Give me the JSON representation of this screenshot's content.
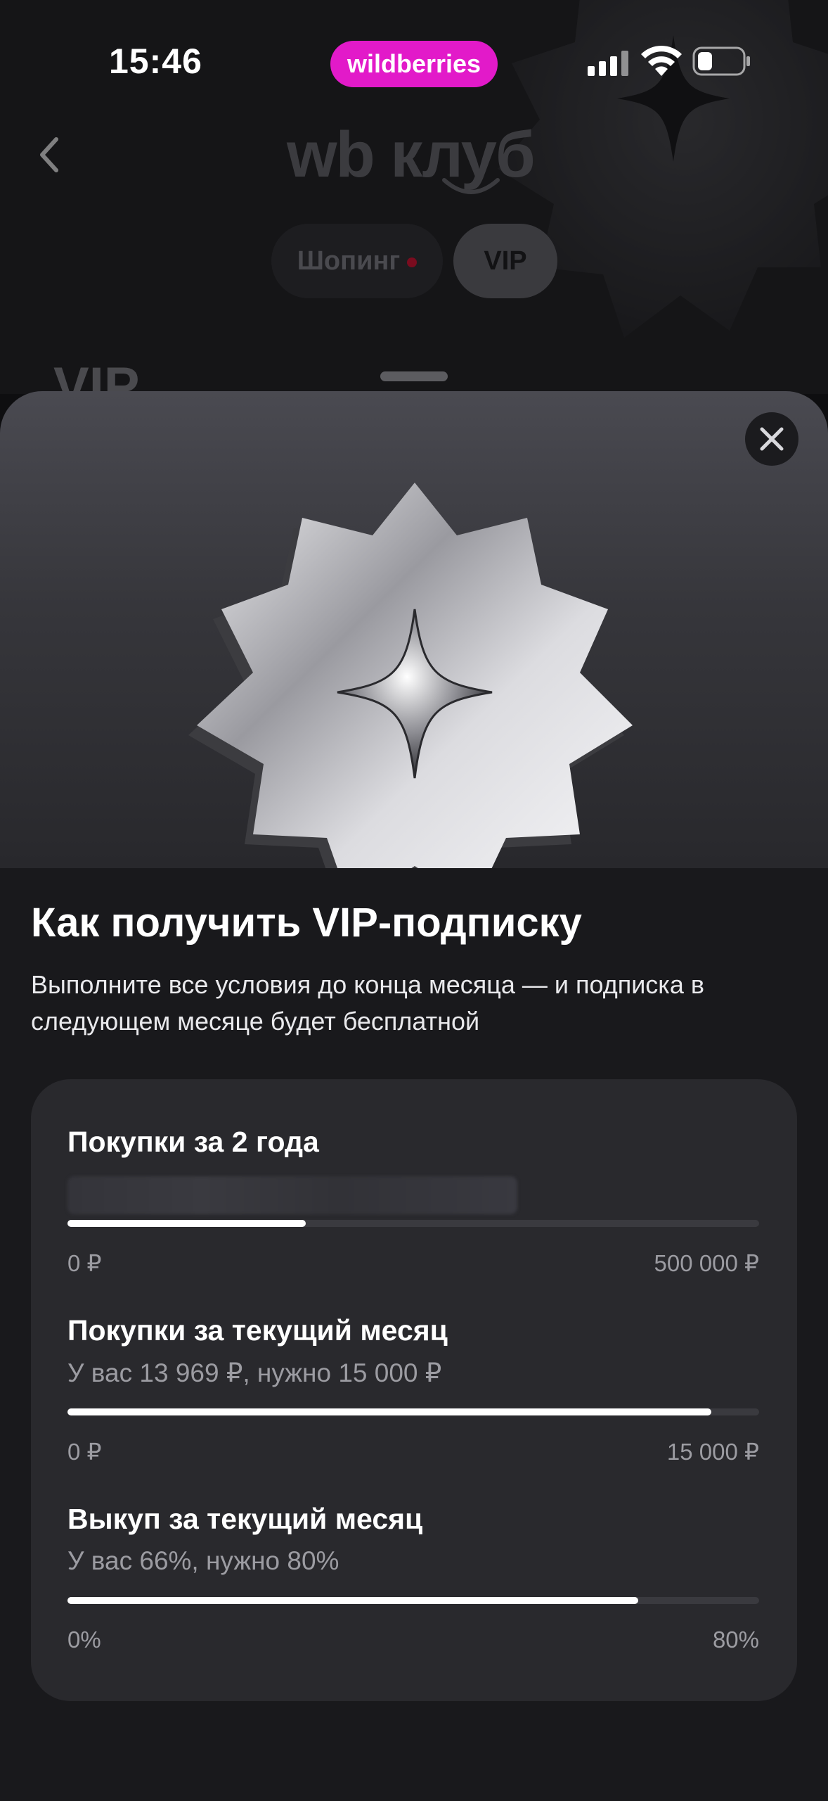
{
  "status_bar": {
    "time": "15:46",
    "brand": "wildberries",
    "brand_color": "#e21ac9",
    "icons": [
      "cellular-signal-icon",
      "wifi-icon",
      "battery-icon"
    ]
  },
  "background_page": {
    "logo": "wb клуб",
    "tabs": [
      {
        "label": "Шопинг",
        "has_notification_dot": true
      },
      {
        "label": "VIP",
        "selected": true
      }
    ],
    "section_title": "VIP"
  },
  "sheet": {
    "title": "Как получить VIP-подписку",
    "subtitle": "Выполните все условия до конца месяца — и подписка в следующем месяце будет бесплатной",
    "conditions": [
      {
        "title": "Покупки за 2 года",
        "subtitle_hidden": true,
        "progress": 0.345,
        "min_label": "0 ₽",
        "max_label": "500 000 ₽"
      },
      {
        "title": "Покупки за текущий месяц",
        "subtitle": "У вас 13 969 ₽, нужно 15 000 ₽",
        "progress": 0.931,
        "min_label": "0 ₽",
        "max_label": "15 000 ₽"
      },
      {
        "title": "Выкуп за текущий месяц",
        "subtitle": "У вас 66%, нужно 80%",
        "progress": 0.825,
        "min_label": "0%",
        "max_label": "80%"
      }
    ]
  }
}
